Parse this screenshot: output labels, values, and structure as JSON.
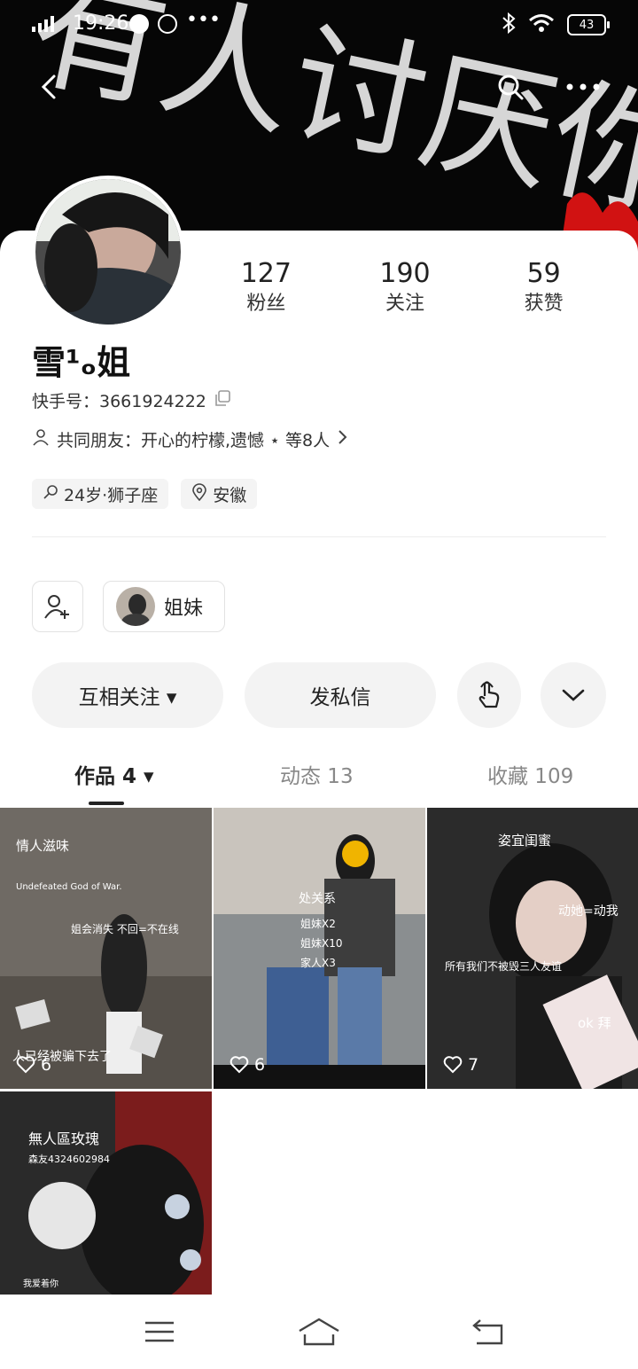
{
  "status_bar": {
    "time": "19:26",
    "battery": "43"
  },
  "banner": {
    "art_text": "有人讨厌你”"
  },
  "profile": {
    "name": "雪¹ₒ姐",
    "uid_label": "快手号：3661924222",
    "mutual_friends": "共同朋友：开心的柠檬,遗憾 ⋆  等8人",
    "tags": [
      "24岁·狮子座",
      "安徽"
    ]
  },
  "stats": [
    {
      "value": "127",
      "label": "粉丝"
    },
    {
      "value": "190",
      "label": "关注"
    },
    {
      "value": "59",
      "label": "获赞"
    }
  ],
  "group_chip": {
    "label": "姐妹"
  },
  "actions": {
    "follow_label": "互相关注 ▾",
    "message_label": "发私信"
  },
  "tabs": [
    {
      "label": "作品 4 ▾"
    },
    {
      "label": "动态 13"
    },
    {
      "label": "收藏 109"
    }
  ],
  "works": [
    {
      "likes": "6",
      "overlay": [
        "情人滋味",
        "Undefeated God of War.",
        "姐会消失 不回=不在线",
        "人已经被骗下去了"
      ]
    },
    {
      "likes": "6",
      "overlay": [
        "处关系",
        "姐妹X2",
        "姐妹X10",
        "家人X3"
      ]
    },
    {
      "likes": "7",
      "overlay": [
        "姿宜闺蜜",
        "动她=动我",
        "所有我们不被毁三人友谊",
        "ok 拜"
      ]
    },
    {
      "likes": "",
      "overlay": [
        "無人區玫瑰",
        "森友4324602984",
        "我爱着你"
      ]
    }
  ],
  "colors": {
    "accent": "#222222",
    "button_bg": "#f3f3f3",
    "banner_bg": "#050505"
  }
}
